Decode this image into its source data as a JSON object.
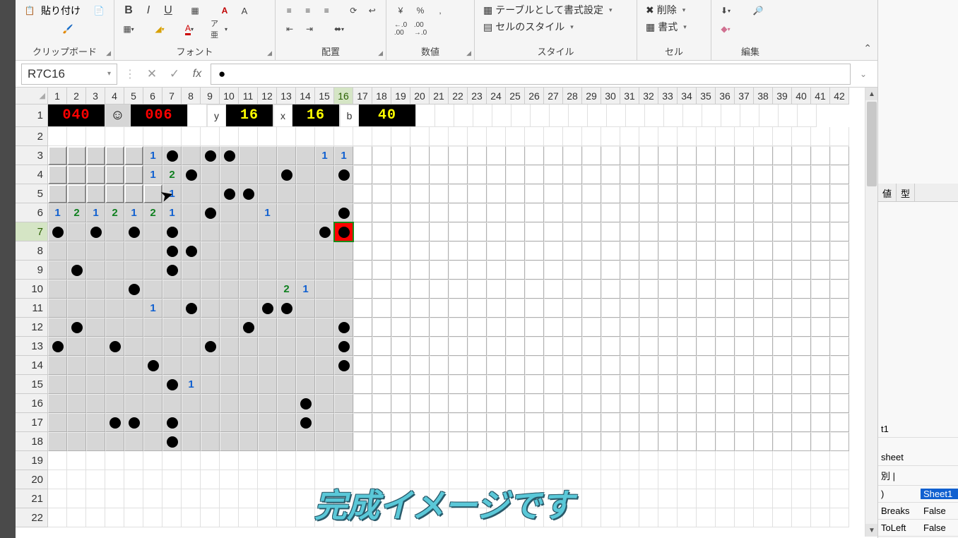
{
  "ribbon": {
    "paste_label": "貼り付け",
    "groups": {
      "clipboard": "クリップボード",
      "font": "フォント",
      "alignment": "配置",
      "number": "数値",
      "styles": "スタイル",
      "cells": "セル",
      "editing": "編集"
    },
    "bold": "B",
    "italic": "I",
    "underline": "U",
    "format_table": "テーブルとして書式設定",
    "cell_styles": "セルのスタイル",
    "delete": "削除",
    "format": "書式",
    "number_general": "%",
    "number_comma": ",",
    "dec_inc": ".0",
    "dec_dec": ".00"
  },
  "name_box": "R7C16",
  "formula_value": "●",
  "col_count": 42,
  "active_col": 16,
  "active_row": 7,
  "row_count": 22,
  "status_row": {
    "counter1": "040",
    "counter2": "006",
    "y_label": "y",
    "y_val": "16",
    "x_label": "x",
    "x_val": "16",
    "b_label": "b",
    "b_val": "40",
    "face": "☺"
  },
  "grid": {
    "width": 16,
    "height": 16,
    "cells": [
      {
        "r": 3,
        "c": 6,
        "t": "n",
        "v": "1"
      },
      {
        "r": 3,
        "c": 7,
        "t": "m"
      },
      {
        "r": 3,
        "c": 9,
        "t": "m"
      },
      {
        "r": 3,
        "c": 10,
        "t": "m"
      },
      {
        "r": 3,
        "c": 15,
        "t": "n",
        "v": "1"
      },
      {
        "r": 3,
        "c": 16,
        "t": "n",
        "v": "1"
      },
      {
        "r": 4,
        "c": 6,
        "t": "n",
        "v": "1"
      },
      {
        "r": 4,
        "c": 7,
        "t": "n2",
        "v": "2"
      },
      {
        "r": 4,
        "c": 8,
        "t": "m"
      },
      {
        "r": 4,
        "c": 13,
        "t": "m"
      },
      {
        "r": 4,
        "c": 16,
        "t": "m"
      },
      {
        "r": 5,
        "c": 7,
        "t": "n",
        "v": "1"
      },
      {
        "r": 5,
        "c": 10,
        "t": "m"
      },
      {
        "r": 5,
        "c": 11,
        "t": "m"
      },
      {
        "r": 6,
        "c": 1,
        "t": "n",
        "v": "1"
      },
      {
        "r": 6,
        "c": 2,
        "t": "n2",
        "v": "2"
      },
      {
        "r": 6,
        "c": 3,
        "t": "n",
        "v": "1"
      },
      {
        "r": 6,
        "c": 4,
        "t": "n2",
        "v": "2"
      },
      {
        "r": 6,
        "c": 5,
        "t": "n",
        "v": "1"
      },
      {
        "r": 6,
        "c": 6,
        "t": "n2",
        "v": "2"
      },
      {
        "r": 6,
        "c": 7,
        "t": "n",
        "v": "1"
      },
      {
        "r": 6,
        "c": 9,
        "t": "m"
      },
      {
        "r": 6,
        "c": 12,
        "t": "n",
        "v": "1"
      },
      {
        "r": 6,
        "c": 16,
        "t": "m"
      },
      {
        "r": 7,
        "c": 1,
        "t": "m"
      },
      {
        "r": 7,
        "c": 3,
        "t": "m"
      },
      {
        "r": 7,
        "c": 5,
        "t": "m"
      },
      {
        "r": 7,
        "c": 7,
        "t": "m"
      },
      {
        "r": 7,
        "c": 15,
        "t": "m"
      },
      {
        "r": 7,
        "c": 16,
        "t": "rm"
      },
      {
        "r": 8,
        "c": 7,
        "t": "m"
      },
      {
        "r": 8,
        "c": 8,
        "t": "m"
      },
      {
        "r": 9,
        "c": 2,
        "t": "m"
      },
      {
        "r": 9,
        "c": 7,
        "t": "m"
      },
      {
        "r": 10,
        "c": 5,
        "t": "m"
      },
      {
        "r": 10,
        "c": 13,
        "t": "n2",
        "v": "2"
      },
      {
        "r": 10,
        "c": 14,
        "t": "n",
        "v": "1"
      },
      {
        "r": 11,
        "c": 6,
        "t": "n",
        "v": "1"
      },
      {
        "r": 11,
        "c": 8,
        "t": "m"
      },
      {
        "r": 11,
        "c": 12,
        "t": "m"
      },
      {
        "r": 11,
        "c": 13,
        "t": "m"
      },
      {
        "r": 12,
        "c": 2,
        "t": "m"
      },
      {
        "r": 12,
        "c": 11,
        "t": "m"
      },
      {
        "r": 12,
        "c": 16,
        "t": "m"
      },
      {
        "r": 13,
        "c": 1,
        "t": "m"
      },
      {
        "r": 13,
        "c": 4,
        "t": "m"
      },
      {
        "r": 13,
        "c": 9,
        "t": "m"
      },
      {
        "r": 13,
        "c": 16,
        "t": "m"
      },
      {
        "r": 14,
        "c": 6,
        "t": "m"
      },
      {
        "r": 14,
        "c": 16,
        "t": "m"
      },
      {
        "r": 15,
        "c": 7,
        "t": "m"
      },
      {
        "r": 15,
        "c": 8,
        "t": "n",
        "v": "1"
      },
      {
        "r": 16,
        "c": 14,
        "t": "m"
      },
      {
        "r": 17,
        "c": 4,
        "t": "m"
      },
      {
        "r": 17,
        "c": 5,
        "t": "m"
      },
      {
        "r": 17,
        "c": 7,
        "t": "m"
      },
      {
        "r": 17,
        "c": 14,
        "t": "m"
      },
      {
        "r": 18,
        "c": 7,
        "t": "m"
      }
    ],
    "raised": [
      {
        "r": 3,
        "c": 1
      },
      {
        "r": 3,
        "c": 2
      },
      {
        "r": 3,
        "c": 3
      },
      {
        "r": 3,
        "c": 4
      },
      {
        "r": 3,
        "c": 5
      },
      {
        "r": 4,
        "c": 1
      },
      {
        "r": 4,
        "c": 2
      },
      {
        "r": 4,
        "c": 3
      },
      {
        "r": 4,
        "c": 4
      },
      {
        "r": 4,
        "c": 5
      },
      {
        "r": 5,
        "c": 1
      },
      {
        "r": 5,
        "c": 2
      },
      {
        "r": 5,
        "c": 3
      },
      {
        "r": 5,
        "c": 4
      },
      {
        "r": 5,
        "c": 5
      },
      {
        "r": 5,
        "c": 6
      }
    ]
  },
  "caption": "完成イメージです",
  "side_panel": {
    "header1": "値",
    "header2": "型",
    "t1": "t1",
    "sheet": "sheet",
    "sep": "別 |",
    "rows": [
      {
        "k": ")",
        "v": "Sheet1",
        "hl": true
      },
      {
        "k": "Breaks",
        "v": "False"
      },
      {
        "k": "ToLeft",
        "v": "False"
      }
    ]
  }
}
